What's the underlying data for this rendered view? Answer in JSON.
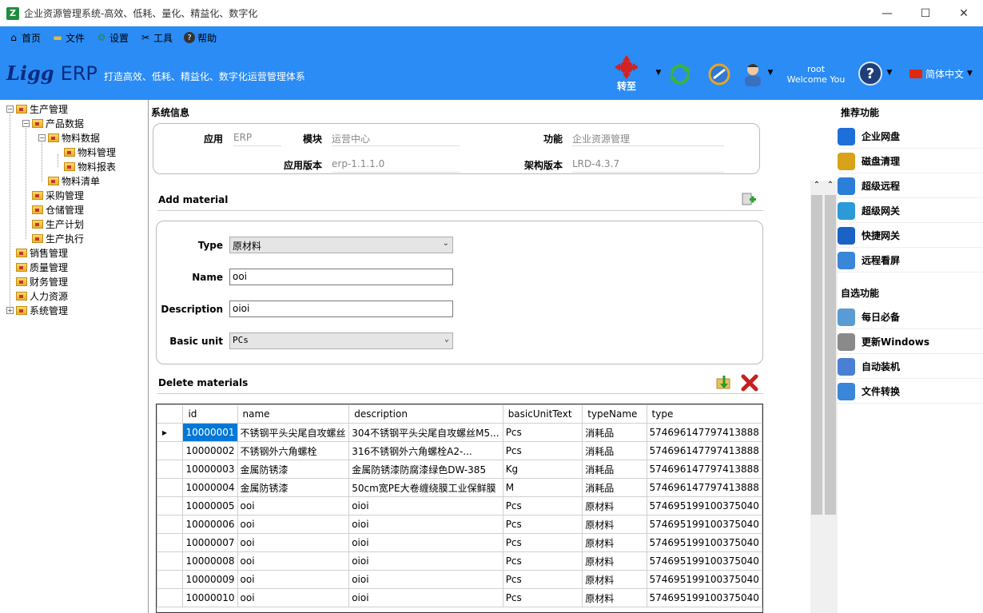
{
  "window": {
    "title": "企业资源管理系统-高效、低耗、量化、精益化、数字化",
    "min": "—",
    "max": "☐",
    "close": "✕"
  },
  "menu": [
    {
      "label": "首页",
      "icon": "home-icon"
    },
    {
      "label": "文件",
      "icon": "folder-icon"
    },
    {
      "label": "设置",
      "icon": "gear-icon"
    },
    {
      "label": "工具",
      "icon": "tools-icon"
    },
    {
      "label": "帮助",
      "icon": "help-icon"
    }
  ],
  "brand": {
    "ligg": "Ligg",
    "erp": "ERP",
    "slogan": "打造高效、低耗、精益化、数字化运营管理体系"
  },
  "toolbar": {
    "goto_label": "转至",
    "user_name": "root",
    "welcome": "Welcome You",
    "language": "简体中文"
  },
  "tree": [
    {
      "label": "生产管理",
      "depth": 0,
      "exp": "−"
    },
    {
      "label": "产品数据",
      "depth": 1,
      "exp": "−"
    },
    {
      "label": "物料数据",
      "depth": 2,
      "exp": "−"
    },
    {
      "label": "物料管理",
      "depth": 3,
      "exp": ""
    },
    {
      "label": "物料报表",
      "depth": 3,
      "exp": ""
    },
    {
      "label": "物料清单",
      "depth": 2,
      "exp": ""
    },
    {
      "label": "采购管理",
      "depth": 1,
      "exp": ""
    },
    {
      "label": "仓储管理",
      "depth": 1,
      "exp": ""
    },
    {
      "label": "生产计划",
      "depth": 1,
      "exp": ""
    },
    {
      "label": "生产执行",
      "depth": 1,
      "exp": ""
    },
    {
      "label": "销售管理",
      "depth": 0,
      "exp": ""
    },
    {
      "label": "质量管理",
      "depth": 0,
      "exp": ""
    },
    {
      "label": "财务管理",
      "depth": 0,
      "exp": ""
    },
    {
      "label": "人力资源",
      "depth": 0,
      "exp": ""
    },
    {
      "label": "系统管理",
      "depth": 0,
      "exp": "+"
    }
  ],
  "sysinfo": {
    "title": "系统信息",
    "app_label": "应用",
    "app_value": "ERP",
    "module_label": "模块",
    "module_value": "运营中心",
    "function_label": "功能",
    "function_value": "企业资源管理",
    "appver_label": "应用版本",
    "appver_value": "erp-1.1.1.0",
    "archver_label": "架构版本",
    "archver_value": "LRD-4.3.7"
  },
  "add": {
    "title": "Add material",
    "type_label": "Type",
    "type_value": "原材料",
    "name_label": "Name",
    "name_value": "ooi",
    "desc_label": "Description",
    "desc_value": "oioi",
    "unit_label": "Basic unit",
    "unit_value": "PCs"
  },
  "delete": {
    "title": "Delete materials"
  },
  "grid": {
    "columns": [
      "id",
      "name",
      "description",
      "basicUnitText",
      "typeName",
      "type"
    ],
    "rows": [
      [
        "10000001",
        "不锈钢平头尖尾自攻螺丝",
        "304不锈钢平头尖尾自攻螺丝M5...",
        "Pcs",
        "消耗品",
        "574696147797413888"
      ],
      [
        "10000002",
        "不锈钢外六角螺栓",
        "316不锈钢外六角螺栓A2-...",
        "Pcs",
        "消耗品",
        "574696147797413888"
      ],
      [
        "10000003",
        "金属防锈漆",
        "金属防锈漆防腐漆绿色DW-385",
        "Kg",
        "消耗品",
        "574696147797413888"
      ],
      [
        "10000004",
        "金属防锈漆",
        "50cm宽PE大卷缠绕膜工业保鲜膜",
        "M",
        "消耗品",
        "574696147797413888"
      ],
      [
        "10000005",
        "ooi",
        "oioi",
        "Pcs",
        "原材料",
        "574695199100375040"
      ],
      [
        "10000006",
        "ooi",
        "oioi",
        "Pcs",
        "原材料",
        "574695199100375040"
      ],
      [
        "10000007",
        "ooi",
        "oioi",
        "Pcs",
        "原材料",
        "574695199100375040"
      ],
      [
        "10000008",
        "ooi",
        "oioi",
        "Pcs",
        "原材料",
        "574695199100375040"
      ],
      [
        "10000009",
        "ooi",
        "oioi",
        "Pcs",
        "原材料",
        "574695199100375040"
      ],
      [
        "10000010",
        "ooi",
        "oioi",
        "Pcs",
        "原材料",
        "574695199100375040"
      ]
    ]
  },
  "recommended": {
    "title": "推荐功能",
    "items": [
      {
        "label": "企业网盘",
        "icon": "cloud-drive-icon",
        "color": "#1e6fd9"
      },
      {
        "label": "磁盘清理",
        "icon": "broom-icon",
        "color": "#d8a21a"
      },
      {
        "label": "超级远程",
        "icon": "remote-icon",
        "color": "#2b7fd6"
      },
      {
        "label": "超级网关",
        "icon": "ie-icon",
        "color": "#2a9ad9"
      },
      {
        "label": "快捷网关",
        "icon": "info-icon",
        "color": "#1a62c4"
      },
      {
        "label": "远程看屏",
        "icon": "monitor-icon",
        "color": "#3a86d8"
      }
    ]
  },
  "custom": {
    "title": "自选功能",
    "items": [
      {
        "label": "每日必备",
        "icon": "document-icon",
        "color": "#5b9bd5"
      },
      {
        "label": "更新Windows",
        "icon": "clock-icon",
        "color": "#8a8a8a"
      },
      {
        "label": "自动装机",
        "icon": "clock-icon",
        "color": "#4a7fd4"
      },
      {
        "label": "文件转换",
        "icon": "monitor-icon",
        "color": "#3a86d8"
      }
    ]
  },
  "colors": {
    "topbar": "#2b8cf5",
    "selection": "#0078d7"
  }
}
